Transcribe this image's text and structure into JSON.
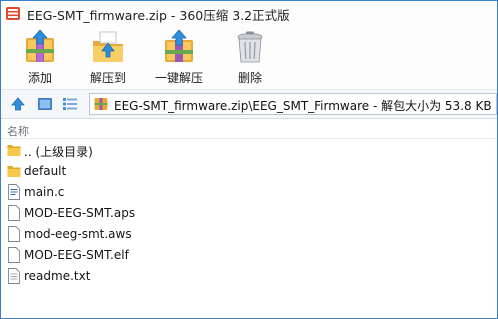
{
  "window": {
    "title": "EEG-SMT_firmware.zip - 360压缩 3.2正式版"
  },
  "toolbar": {
    "buttons": [
      {
        "label": "添加",
        "icon": "add-archive-icon"
      },
      {
        "label": "解压到",
        "icon": "extract-to-icon"
      },
      {
        "label": "一键解压",
        "icon": "one-click-extract-icon"
      },
      {
        "label": "删除",
        "icon": "trash-icon"
      }
    ]
  },
  "addressbar": {
    "path": "EEG-SMT_firmware.zip\\EEG_SMT_Firmware - 解包大小为 53.8 KB"
  },
  "list": {
    "column_name": "名称",
    "items": [
      {
        "name": ".. (上级目录)",
        "type": "folder-up"
      },
      {
        "name": "default",
        "type": "folder"
      },
      {
        "name": "main.c",
        "type": "c-file"
      },
      {
        "name": "MOD-EEG-SMT.aps",
        "type": "file"
      },
      {
        "name": "mod-eeg-smt.aws",
        "type": "file"
      },
      {
        "name": "MOD-EEG-SMT.elf",
        "type": "file"
      },
      {
        "name": "readme.txt",
        "type": "text-file"
      }
    ]
  },
  "colors": {
    "accent": "#3a7fc9",
    "folder": "#f2c13c",
    "arrow": "#2f8fdc"
  }
}
